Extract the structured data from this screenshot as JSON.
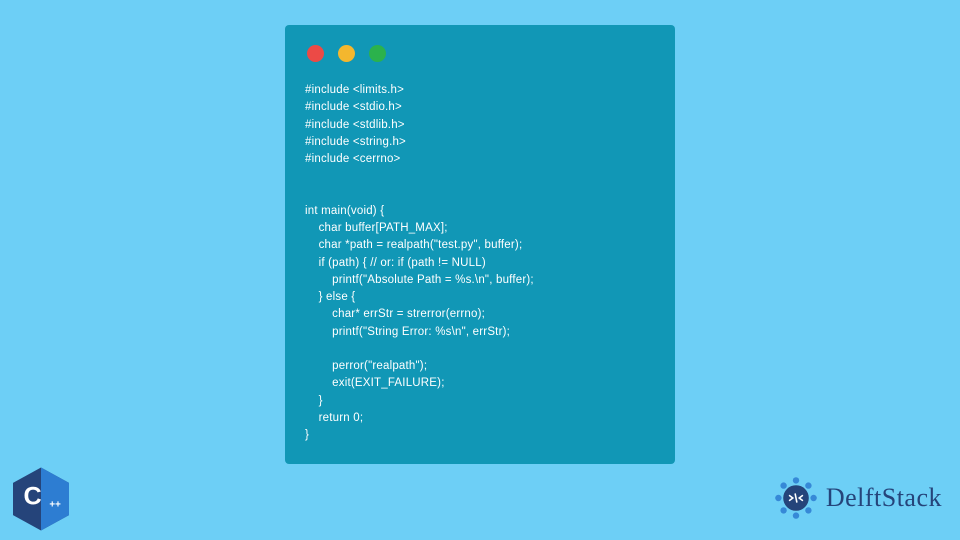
{
  "code": {
    "line1": "#include <limits.h>",
    "line2": "#include <stdio.h>",
    "line3": "#include <stdlib.h>",
    "line4": "#include <string.h>",
    "line5": "#include <cerrno>",
    "line6": "",
    "line7": "",
    "line8": "int main(void) {",
    "line9": "    char buffer[PATH_MAX];",
    "line10": "    char *path = realpath(\"test.py\", buffer);",
    "line11": "    if (path) { // or: if (path != NULL)",
    "line12": "        printf(\"Absolute Path = %s.\\n\", buffer);",
    "line13": "    } else {",
    "line14": "        char* errStr = strerror(errno);",
    "line15": "        printf(\"String Error: %s\\n\", errStr);",
    "line16": "",
    "line17": "        perror(\"realpath\");",
    "line18": "        exit(EXIT_FAILURE);",
    "line19": "    }",
    "line20": "    return 0;",
    "line21": "}"
  },
  "brand": {
    "name": "DelftStack"
  },
  "colors": {
    "background": "#6dcff6",
    "codeWindow": "#1197b6",
    "trafficRed": "#ec4a46",
    "trafficYellow": "#f4b72e",
    "trafficGreen": "#2bb24c",
    "brandBlue": "#25447a",
    "brandAccent": "#2d7dd2"
  }
}
